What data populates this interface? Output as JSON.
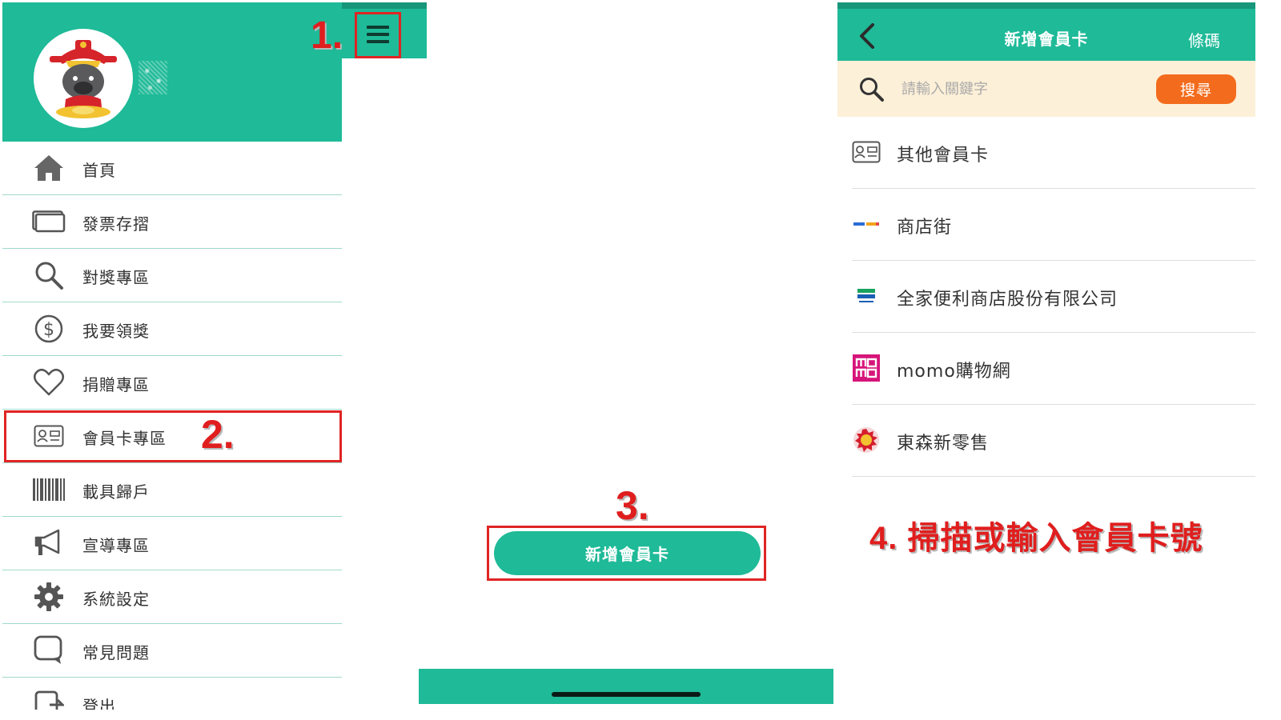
{
  "steps": {
    "one": "1.",
    "two": "2.",
    "three": "3.",
    "four": "4. 掃描或輸入會員卡號"
  },
  "menu": {
    "items": [
      {
        "label": "首頁",
        "icon": "home-icon"
      },
      {
        "label": "發票存摺",
        "icon": "invoice-book-icon"
      },
      {
        "label": "對獎專區",
        "icon": "search-icon"
      },
      {
        "label": "我要領獎",
        "icon": "dollar-icon"
      },
      {
        "label": "捐贈專區",
        "icon": "heart-icon"
      },
      {
        "label": "會員卡專區",
        "icon": "member-card-icon"
      },
      {
        "label": "載具歸戶",
        "icon": "barcode-icon"
      },
      {
        "label": "宣導專區",
        "icon": "megaphone-icon"
      },
      {
        "label": "系統設定",
        "icon": "gear-icon"
      },
      {
        "label": "常見問題",
        "icon": "question-bubble-icon"
      },
      {
        "label": "登出",
        "icon": "logout-icon"
      }
    ]
  },
  "middle": {
    "add_card_button": "新增會員卡"
  },
  "card_page": {
    "title": "新增會員卡",
    "barcode_link": "條碼",
    "search_placeholder": "請輸入關鍵字",
    "search_button": "搜尋",
    "cards": [
      {
        "label": "其他會員卡",
        "icon": "member-card-icon"
      },
      {
        "label": "商店街",
        "icon": "pchome-store-logo-icon"
      },
      {
        "label": "全家便利商店股份有限公司",
        "icon": "familymart-logo-icon"
      },
      {
        "label": "momo購物網",
        "icon": "momo-logo-icon"
      },
      {
        "label": "東森新零售",
        "icon": "etmall-logo-icon"
      }
    ]
  },
  "colors": {
    "brand_green": "#1fba98",
    "brand_green_dark": "#17967a",
    "highlight_red": "#e02424",
    "search_bg": "#fdf0d8",
    "search_button": "#f36c1d"
  }
}
